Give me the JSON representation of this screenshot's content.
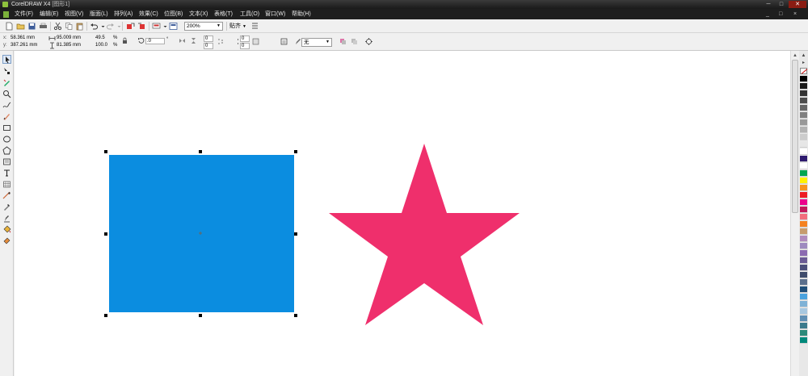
{
  "window": {
    "app_title": "CorelDRAW X4",
    "doc_title": "[图形1]",
    "minimize_glyph": "─",
    "maximize_glyph": "□",
    "close_glyph": "✕"
  },
  "menu": {
    "items": [
      "文件(F)",
      "编辑(E)",
      "视图(V)",
      "版面(L)",
      "排列(A)",
      "效果(C)",
      "位图(B)",
      "文本(X)",
      "表格(T)",
      "工具(O)",
      "窗口(W)",
      "帮助(H)"
    ],
    "right_controls": [
      "_",
      "□",
      "×"
    ]
  },
  "standard_toolbar": {
    "zoom_value": "200%",
    "snap_label": "贴齐"
  },
  "property_bar": {
    "x_label": "x:",
    "x_value": "58.361 mm",
    "y_label": "y:",
    "y_value": "387.261 mm",
    "width_value": "95.009 mm",
    "height_value": "81.385 mm",
    "scale_w": "49.5",
    "scale_h": "100.0",
    "percent_w": "%",
    "percent_h": "%",
    "rotation_value": ".0",
    "degree": "°",
    "corner_tl": "0",
    "corner_bl": "0",
    "corner_tr": "0",
    "corner_br": "0",
    "outline_label": "无"
  },
  "toolbox": {
    "tools": [
      "pick",
      "shape",
      "smart-fill",
      "zoom",
      "freehand",
      "smart-draw",
      "rectangle",
      "ellipse",
      "polygon",
      "text",
      "table",
      "parallel-dimension",
      "eyedropper",
      "outline",
      "fill",
      "interactive-fill"
    ]
  },
  "palette": {
    "colors": [
      "#000000",
      "#1a1a1a",
      "#333333",
      "#4d4d4d",
      "#666666",
      "#808080",
      "#999999",
      "#b3b3b3",
      "#cccccc",
      "#e6e6e6",
      "#ffffff",
      "#2e1a6e",
      "#ffffff",
      "#00a651",
      "#fff200",
      "#f7941d",
      "#ed1c24",
      "#ec008c",
      "#c2185b",
      "#f26d7d",
      "#f58220",
      "#c69c6d",
      "#b08bbd",
      "#9e8bbf",
      "#8c6bb1",
      "#6b5b95",
      "#4b4f7a",
      "#3f4c6b",
      "#5b6f8c",
      "#1f4e79",
      "#4aa3df",
      "#7fb2d6",
      "#a8c8e0",
      "#5f8fb4",
      "#3b7a8c",
      "#2d8a7a",
      "#00897b"
    ]
  },
  "canvas": {
    "rectangle_fill": "#0b8de0",
    "star_fill": "#ef2f6c",
    "selection_handle_color": "#000000"
  }
}
